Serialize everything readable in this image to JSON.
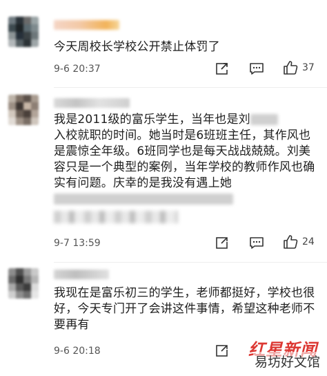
{
  "comments": [
    {
      "text": "今天周校长学校公开禁止体罚了",
      "time": "9-6 20:37",
      "likes": "37"
    },
    {
      "text_part1": "我是2011级的富乐学生，当年也是刘",
      "text_part2": "入校就职的时间。她当时是6班班主任，其作风也是震惊全年级。6班同学也是每天战战兢兢。刘美容只是一个典型的案例，当年学校的教师作风也确实有问题。庆幸的是我没有遇上她",
      "time": "9-7 13:59",
      "likes": "24"
    },
    {
      "text": "我现在是富乐初三的学生，老师都挺好，学校也很好，今天专门开了会讲这件事情，希望这种老师不要再有",
      "time": "9-6 20:18"
    }
  ],
  "watermark": {
    "brand": "红星新闻",
    "site": "易坊好文馆"
  },
  "icons": {
    "share": "share-icon",
    "comment": "comment-icon",
    "like": "thumbs-up-icon"
  }
}
